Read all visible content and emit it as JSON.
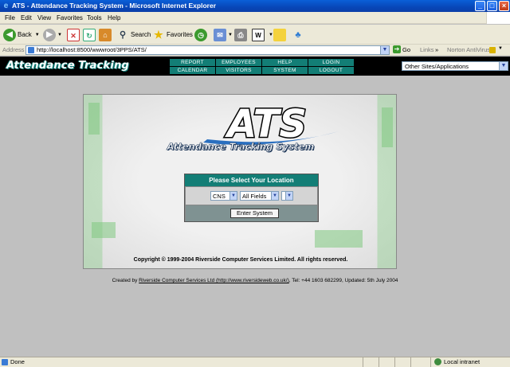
{
  "window": {
    "title": "ATS - Attendance Tracking System - Microsoft Internet Explorer",
    "controls": [
      "_",
      "□",
      "×"
    ]
  },
  "menu": [
    "File",
    "Edit",
    "View",
    "Favorites",
    "Tools",
    "Help"
  ],
  "toolbar": {
    "back": "Back",
    "search": "Search",
    "favorites": "Favorites"
  },
  "address": {
    "label": "Address",
    "url": "http://localhost:8500/wwwroot/3PPS/ATS/",
    "go": "Go",
    "links": "Links",
    "chevron": "»",
    "norton": "Norton AntiVirus"
  },
  "site": {
    "logo": "Attendance Tracking",
    "nav": {
      "report": "REPORT",
      "employees": "EMPLOYEES",
      "help": "HELP",
      "login": "LOGIN",
      "calendar": "CALENDAR",
      "visitors": "VISITORS",
      "system": "SYSTEM",
      "logout": "LOGOUT"
    },
    "site_select": "Other Sites/Applications"
  },
  "card": {
    "logo_text": "ATS",
    "subtitle": "Attendance Tracking System",
    "location_heading": "Please Select Your Location",
    "select_site": "CNS",
    "select_fields": "All Fields",
    "select_third": "",
    "enter_button": "Enter System",
    "copyright": "Copyright © 1999-2004 Riverside Computer Services Limited. All rights reserved."
  },
  "footer": {
    "prefix": "Created by ",
    "link": "Riverside Computer Services Ltd (http://www.riversideweb.co.uk/)",
    "suffix": ", Tel: +44 1603 682299, Updated: 5th July 2004"
  },
  "status": {
    "text": "Done",
    "zone": "Local intranet"
  },
  "colors": {
    "teal": "#137e76",
    "header_bg": "#000000",
    "page_bg": "#c0c0c0"
  }
}
